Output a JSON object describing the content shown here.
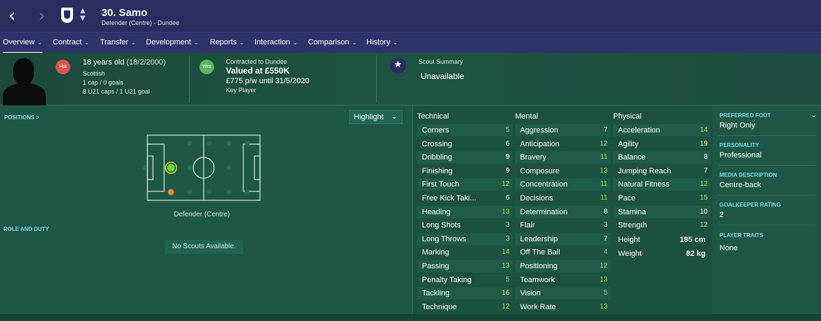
{
  "header": {
    "back_icon": "‹",
    "forward_icon": "›",
    "updown_up": "▲",
    "updown_down": "▼",
    "player_name": "30. Samo",
    "player_subtitle": "Defender (Centre) - Dundee"
  },
  "tabs": [
    {
      "label": "Overview",
      "active": true
    },
    {
      "label": "Contract"
    },
    {
      "label": "Transfer"
    },
    {
      "label": "Development"
    },
    {
      "label": "Reports"
    },
    {
      "label": "Interaction"
    },
    {
      "label": "Comparison"
    },
    {
      "label": "History"
    }
  ],
  "chevron": "⌄",
  "info": {
    "nation_badge": "Hol",
    "age": "18 years old",
    "dob": "(18/2/2000)",
    "nationality": "Scottish",
    "caps": "1 cap / 0 goals",
    "u21_caps": "8 U21 caps / 1 U21 goal",
    "transfer_badge": "Wnt",
    "contract_label": "Contracted to Dundee",
    "value": "Valued at £550K",
    "wage": "£775 p/w until 31/5/2020",
    "squad_status": "Key Player",
    "scout_label": "Scout Summary",
    "scout_value": "Unavailable",
    "star_icon": "★"
  },
  "left": {
    "positions_label": "POSITIONS >",
    "highlight_label": "Highlight",
    "position_caption": "Defender (Centre)",
    "role_label": "ROLE AND DUTY",
    "no_scouts": "No Scouts Available."
  },
  "attributes": {
    "technical_header": "Technical",
    "mental_header": "Mental",
    "physical_header": "Physical",
    "technical": [
      {
        "name": "Corners",
        "value": "5"
      },
      {
        "name": "Crossing",
        "value": "6"
      },
      {
        "name": "Dribbling",
        "value": "9"
      },
      {
        "name": "Finishing",
        "value": "9"
      },
      {
        "name": "First Touch",
        "value": "12"
      },
      {
        "name": "Free Kick Taki...",
        "value": "6"
      },
      {
        "name": "Heading",
        "value": "13"
      },
      {
        "name": "Long Shots",
        "value": "3"
      },
      {
        "name": "Long Throws",
        "value": "3"
      },
      {
        "name": "Marking",
        "value": "14"
      },
      {
        "name": "Passing",
        "value": "13"
      },
      {
        "name": "Penalty Taking",
        "value": "5"
      },
      {
        "name": "Tackling",
        "value": "16"
      },
      {
        "name": "Technique",
        "value": "12"
      }
    ],
    "mental": [
      {
        "name": "Aggression",
        "value": "7"
      },
      {
        "name": "Anticipation",
        "value": "12"
      },
      {
        "name": "Bravery",
        "value": "11"
      },
      {
        "name": "Composure",
        "value": "13"
      },
      {
        "name": "Concentration",
        "value": "11"
      },
      {
        "name": "Decisions",
        "value": "11"
      },
      {
        "name": "Determination",
        "value": "8"
      },
      {
        "name": "Flair",
        "value": "3"
      },
      {
        "name": "Leadership",
        "value": "7"
      },
      {
        "name": "Off The Ball",
        "value": "4"
      },
      {
        "name": "Positioning",
        "value": "12"
      },
      {
        "name": "Teamwork",
        "value": "13"
      },
      {
        "name": "Vision",
        "value": "5"
      },
      {
        "name": "Work Rate",
        "value": "13"
      }
    ],
    "physical": [
      {
        "name": "Acceleration",
        "value": "14"
      },
      {
        "name": "Agility",
        "value": "19"
      },
      {
        "name": "Balance",
        "value": "8"
      },
      {
        "name": "Jumping Reach",
        "value": "7"
      },
      {
        "name": "Natural Fitness",
        "value": "12"
      },
      {
        "name": "Pace",
        "value": "15"
      },
      {
        "name": "Stamina",
        "value": "10"
      },
      {
        "name": "Strength",
        "value": "12"
      }
    ],
    "height_label": "Height",
    "height_value": "185 cm",
    "weight_label": "Weight",
    "weight_value": "82 kg"
  },
  "side": {
    "preferred_foot_label": "PREFERRED FOOT",
    "preferred_foot": "Right Only",
    "personality_label": "PERSONALITY",
    "personality": "Professional",
    "media_label": "MEDIA DESCRIPTION",
    "media": "Centre-back",
    "gk_label": "GOALKEEPER RATING",
    "gk": "2",
    "traits_label": "PLAYER TRAITS",
    "traits": "None"
  },
  "colors": {
    "value_high": "#a3e04a",
    "value_mid": "#ffffff",
    "value_low": "#a9bfb7",
    "value_top": "#ffe14f"
  }
}
